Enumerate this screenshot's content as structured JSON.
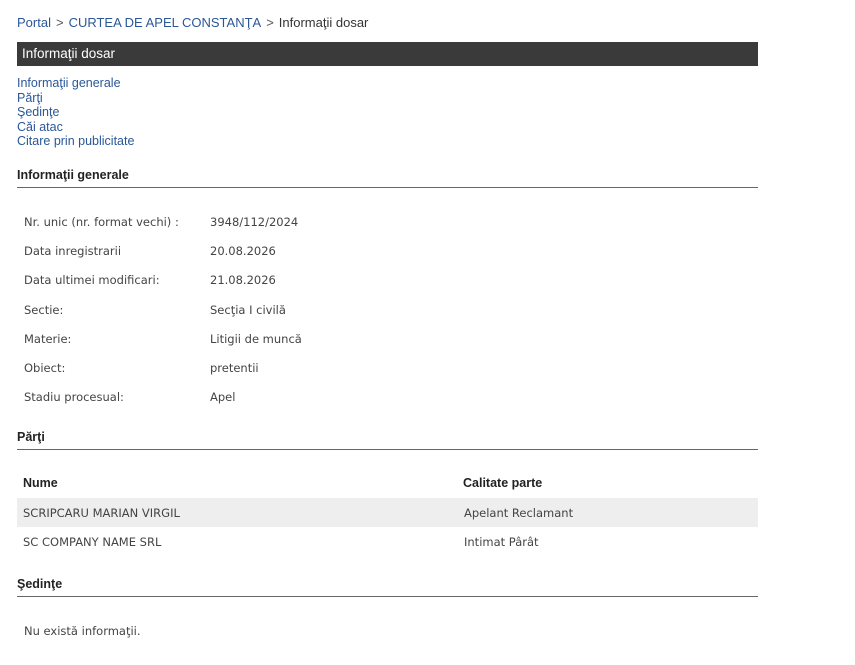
{
  "breadcrumb": {
    "portal": "Portal",
    "court": "CURTEA DE APEL CONSTANŢA",
    "current": "Informaţii dosar",
    "separator": ">"
  },
  "header": {
    "title": "Informaţii dosar"
  },
  "nav": {
    "items": [
      "Informaţii generale",
      "Părţi",
      "Şedinţe",
      "Căi atac",
      "Citare prin publicitate"
    ]
  },
  "general": {
    "title": "Informaţii generale",
    "rows": [
      {
        "label": "Nr. unic (nr. format vechi) :",
        "value": "3948/112/2024"
      },
      {
        "label": "Data inregistrarii",
        "value": "20.08.2026"
      },
      {
        "label": "Data ultimei modificari:",
        "value": "21.08.2026"
      },
      {
        "label": "Sectie:",
        "value": "Secţia I civilă"
      },
      {
        "label": "Materie:",
        "value": "Litigii de muncă"
      },
      {
        "label": "Obiect:",
        "value": "pretentii"
      },
      {
        "label": "Stadiu procesual:",
        "value": "Apel"
      }
    ]
  },
  "parti": {
    "title": "Părţi",
    "columns": [
      "Nume",
      "Calitate parte"
    ],
    "rows": [
      {
        "name": "SCRIPCARU MARIAN VIRGIL",
        "role": "Apelant Reclamant"
      },
      {
        "name": "SC COMPANY NAME SRL",
        "role": "Intimat Pârât"
      }
    ]
  },
  "sedinte": {
    "title": "Şedinţe",
    "empty_text": "Nu există informaţii."
  }
}
